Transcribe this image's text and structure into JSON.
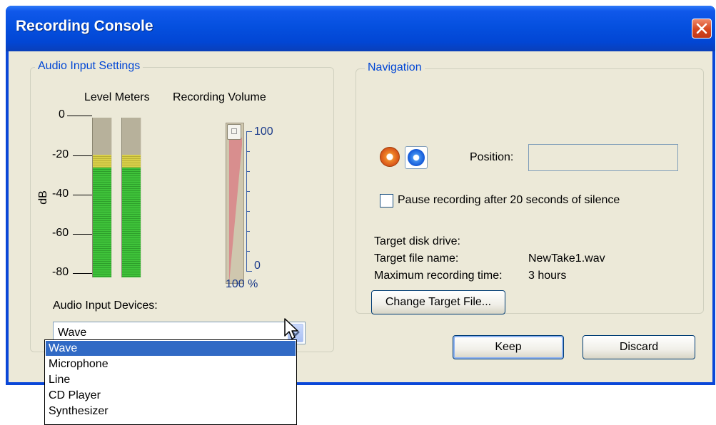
{
  "window": {
    "title": "Recording Console"
  },
  "audio_settings": {
    "group_title": "Audio Input Settings",
    "level_meters_label": "Level Meters",
    "recording_volume_label": "Recording Volume",
    "db_unit": "dB",
    "db_ticks": [
      "0",
      "-20",
      "-40",
      "-60",
      "-80"
    ],
    "volume_scale_max": "100",
    "volume_scale_min": "0",
    "volume_readout": "100 %",
    "volume_level_percent": 100,
    "devices_label": "Audio Input Devices:",
    "selected_device": "Wave",
    "device_options": [
      "Wave",
      "Microphone",
      "Line",
      "CD Player",
      "Synthesizer"
    ]
  },
  "navigation": {
    "group_title": "Navigation",
    "position_label": "Position:",
    "position_value": "",
    "pause_checkbox_label": "Pause recording after 20 seconds of silence",
    "pause_checked": false,
    "target_disk_label": "Target disk drive:",
    "target_disk_value": "",
    "target_file_label": "Target file name:",
    "target_file_value": "NewTake1.wav",
    "max_time_label": "Maximum recording time:",
    "max_time_value": "3 hours",
    "change_target_button": "Change Target File..."
  },
  "buttons": {
    "keep": "Keep",
    "discard": "Discard"
  },
  "icons": {
    "record": "record-icon",
    "stop": "stop-icon",
    "close": "close-icon",
    "combo_arrow": "chevron-down-icon",
    "cursor": "mouse-pointer-icon"
  },
  "colors": {
    "titlebar": "#0550df",
    "group_title": "#0046d5",
    "selection": "#316ac5",
    "close_button": "#d6451d"
  }
}
